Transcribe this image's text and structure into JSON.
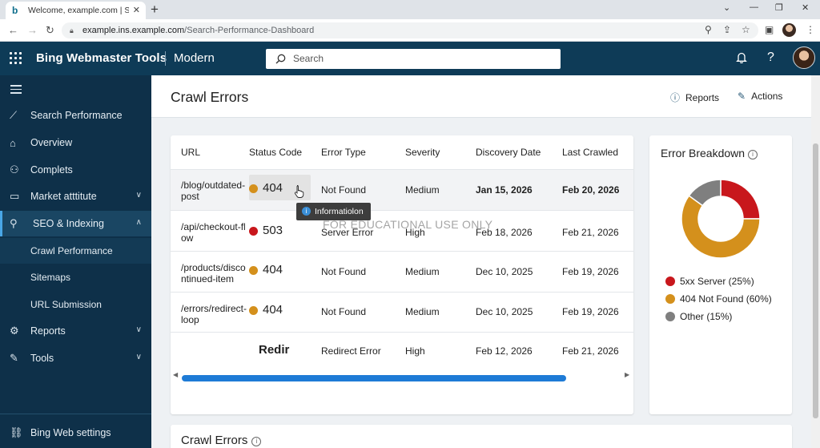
{
  "browser": {
    "tab_title": "Welcome, example.com | Search",
    "url_domain": "example.ins.example.com",
    "url_path": "/Search-Performance-Dashboard"
  },
  "app": {
    "brand": "Bing Webmaster Tools",
    "mode": "Modern",
    "search_placeholder": "Search"
  },
  "sidebar": {
    "items": [
      {
        "label": "Search Performance",
        "icon": "chart-line-icon"
      },
      {
        "label": "Overview",
        "icon": "home-icon"
      },
      {
        "label": "Complets",
        "icon": "users-icon"
      },
      {
        "label": "Market atttitute",
        "icon": "monitor-icon",
        "chevron": "down"
      },
      {
        "label": "SEO & Indexing",
        "icon": "search-icon",
        "chevron": "up",
        "active": true
      },
      {
        "label": "Reports",
        "icon": "gear-icon",
        "chevron": "down"
      },
      {
        "label": "Tools",
        "icon": "wrench-icon",
        "chevron": "down"
      }
    ],
    "sub_items": [
      {
        "label": "Crawl Performance",
        "current": true
      },
      {
        "label": "Sitemaps"
      },
      {
        "label": "URL Submission"
      }
    ],
    "footer": {
      "label": "Bing Web settings",
      "icon": "link-icon"
    }
  },
  "page": {
    "title": "Crawl Errors",
    "reports_label": "Reports",
    "actions_label": "Actions"
  },
  "table": {
    "columns": [
      "URL",
      "Status Code",
      "Error Type",
      "Severity",
      "Discovery Date",
      "Last Crawled"
    ],
    "rows": [
      {
        "url": "/blog/outdated-post",
        "status": "404",
        "status_color": "#d4901c",
        "error_type": "Not Found",
        "severity": "Medium",
        "discovery": "Jan 15, 2026",
        "last_crawled": "Feb 20, 2026",
        "dates_bold": true,
        "hover": true
      },
      {
        "url": "/api/checkout-flow",
        "status": "503",
        "status_color": "#c8171c",
        "error_type": "Server Error",
        "severity": "High",
        "discovery": "Feb 18, 2026",
        "last_crawled": "Feb 21, 2026"
      },
      {
        "url": "/products/discontinued-item",
        "status": "404",
        "status_color": "#d4901c",
        "error_type": "Not Found",
        "severity": "Medium",
        "discovery": "Dec 10, 2025",
        "last_crawled": "Feb 19, 2026"
      },
      {
        "url": "/errors/redirect-loop",
        "status": "404",
        "status_color": "#d4901c",
        "error_type": "Not Found",
        "severity": "Medium",
        "discovery": "Dec 10, 2025",
        "last_crawled": "Feb 19, 2026"
      },
      {
        "url": "",
        "status": "Redir",
        "status_color": "",
        "error_type": "Redirect Error",
        "severity": "High",
        "discovery": "Feb 12, 2026",
        "last_crawled": "Feb 21, 2026"
      }
    ],
    "tooltip": "Informatiolon",
    "watermark": "FOR EDUCATIONAL USE ONLY",
    "scroll_fraction": 0.87
  },
  "breakdown": {
    "title": "Error Breakdown",
    "slices": [
      {
        "label": "5xx Server (25%)",
        "value": 25,
        "color": "#c8171c"
      },
      {
        "label": "404 Not Found (60%)",
        "value": 60,
        "color": "#d4901c"
      },
      {
        "label": "Other (15%)",
        "value": 15,
        "color": "#7f7f7f"
      }
    ]
  },
  "bottom_card": {
    "title": "Crawl Errors"
  }
}
